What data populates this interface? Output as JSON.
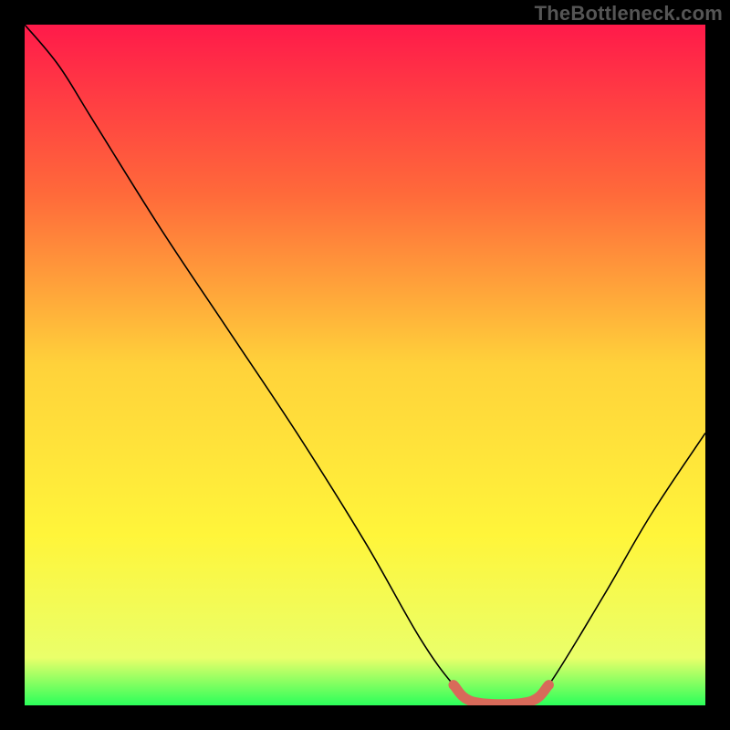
{
  "watermark": "TheBottleneck.com",
  "chart_data": {
    "type": "line",
    "title": "",
    "xlabel": "",
    "ylabel": "",
    "xlim": [
      0,
      100
    ],
    "ylim": [
      0,
      100
    ],
    "gradient_stops": [
      {
        "offset": 0,
        "color": "#ff1a4a"
      },
      {
        "offset": 0.25,
        "color": "#ff6a3a"
      },
      {
        "offset": 0.5,
        "color": "#ffd23a"
      },
      {
        "offset": 0.75,
        "color": "#fff53a"
      },
      {
        "offset": 0.93,
        "color": "#eaff6a"
      },
      {
        "offset": 1.0,
        "color": "#2bff5a"
      }
    ],
    "series": [
      {
        "name": "bottleneck-curve",
        "color": "#000000",
        "width": 1.6,
        "points": [
          {
            "x": 0,
            "y": 100
          },
          {
            "x": 5,
            "y": 94
          },
          {
            "x": 10,
            "y": 86
          },
          {
            "x": 20,
            "y": 70
          },
          {
            "x": 30,
            "y": 55
          },
          {
            "x": 40,
            "y": 40
          },
          {
            "x": 50,
            "y": 24
          },
          {
            "x": 58,
            "y": 10
          },
          {
            "x": 63,
            "y": 3
          },
          {
            "x": 66,
            "y": 0.5
          },
          {
            "x": 74,
            "y": 0.5
          },
          {
            "x": 77,
            "y": 3
          },
          {
            "x": 85,
            "y": 16
          },
          {
            "x": 92,
            "y": 28
          },
          {
            "x": 100,
            "y": 40
          }
        ]
      },
      {
        "name": "min-segment",
        "color": "#d86a5a",
        "width": 11,
        "points": [
          {
            "x": 63,
            "y": 3
          },
          {
            "x": 66,
            "y": 0.5
          },
          {
            "x": 74,
            "y": 0.5
          },
          {
            "x": 77,
            "y": 3
          }
        ]
      }
    ]
  }
}
